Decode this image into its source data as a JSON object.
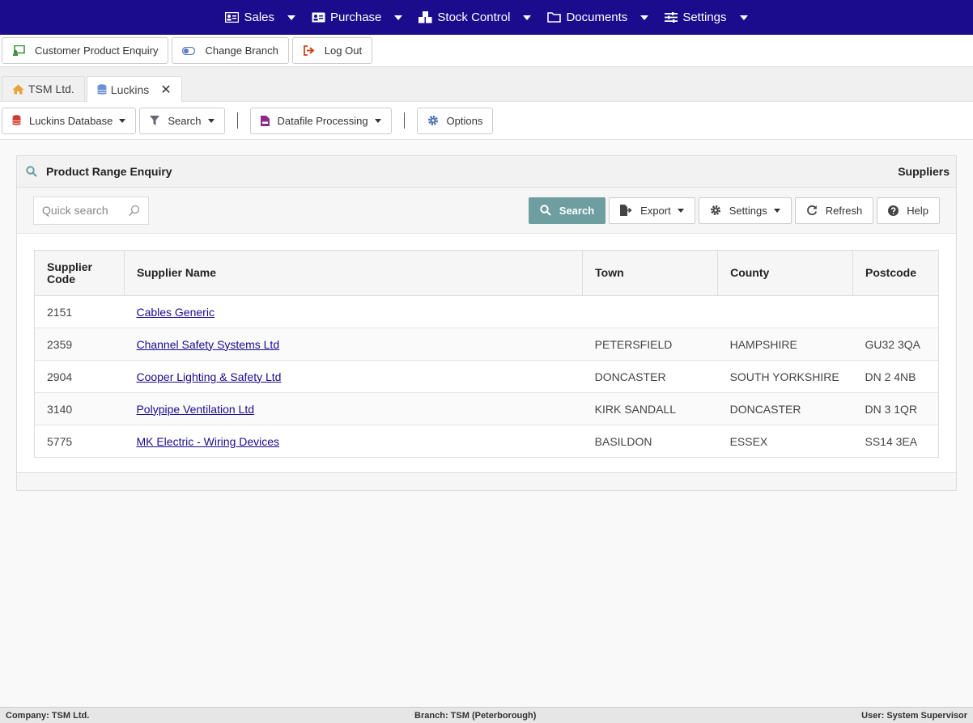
{
  "topnav": {
    "items": [
      {
        "label": "Sales",
        "icon": "id-card-icon"
      },
      {
        "label": "Purchase",
        "icon": "id-card-icon"
      },
      {
        "label": "Stock Control",
        "icon": "boxes-icon"
      },
      {
        "label": "Documents",
        "icon": "folder-icon"
      },
      {
        "label": "Settings",
        "icon": "sliders-icon"
      }
    ]
  },
  "actionbar": {
    "customer_enquiry": "Customer Product Enquiry",
    "change_branch": "Change Branch",
    "log_out": "Log Out"
  },
  "tabs": [
    {
      "label": "TSM Ltd.",
      "icon": "home-icon"
    },
    {
      "label": "Luckins",
      "icon": "database-icon",
      "close": "✕"
    }
  ],
  "toolbar": {
    "database": "Luckins Database",
    "search": "Search",
    "datafile": "Datafile Processing",
    "options": "Options"
  },
  "panel": {
    "title": "Product Range Enquiry",
    "right_label": "Suppliers",
    "quick_search_placeholder": "Quick search",
    "buttons": {
      "search": "Search",
      "export": "Export",
      "settings": "Settings",
      "refresh": "Refresh",
      "help": "Help"
    }
  },
  "table": {
    "headers": {
      "code_line1": "Supplier",
      "code_line2": "Code",
      "name": "Supplier Name",
      "town": "Town",
      "county": "County",
      "postcode": "Postcode"
    },
    "rows": [
      {
        "code": "2151",
        "name": "Cables Generic",
        "town": "",
        "county": "",
        "postcode": ""
      },
      {
        "code": "2359",
        "name": "Channel Safety Systems Ltd",
        "town": "PETERSFIELD",
        "county": "HAMPSHIRE",
        "postcode": "GU32 3QA"
      },
      {
        "code": "2904",
        "name": "Cooper Lighting & Safety Ltd",
        "town": "DONCASTER",
        "county": "SOUTH YORKSHIRE",
        "postcode": "DN 2 4NB"
      },
      {
        "code": "3140",
        "name": "Polypipe Ventilation Ltd",
        "town": "KIRK SANDALL",
        "county": "DONCASTER",
        "postcode": "DN 3 1QR"
      },
      {
        "code": "5775",
        "name": "MK Electric - Wiring Devices",
        "town": "BASILDON",
        "county": "ESSEX",
        "postcode": "SS14 3EA"
      }
    ]
  },
  "statusbar": {
    "company": "Company: TSM Ltd.",
    "branch": "Branch: TSM (Peterborough)",
    "user": "User: System Supervisor"
  },
  "colors": {
    "nav": "#1a0c8c",
    "primary_button": "#6e9ea0",
    "link": "#1a0c8c"
  }
}
